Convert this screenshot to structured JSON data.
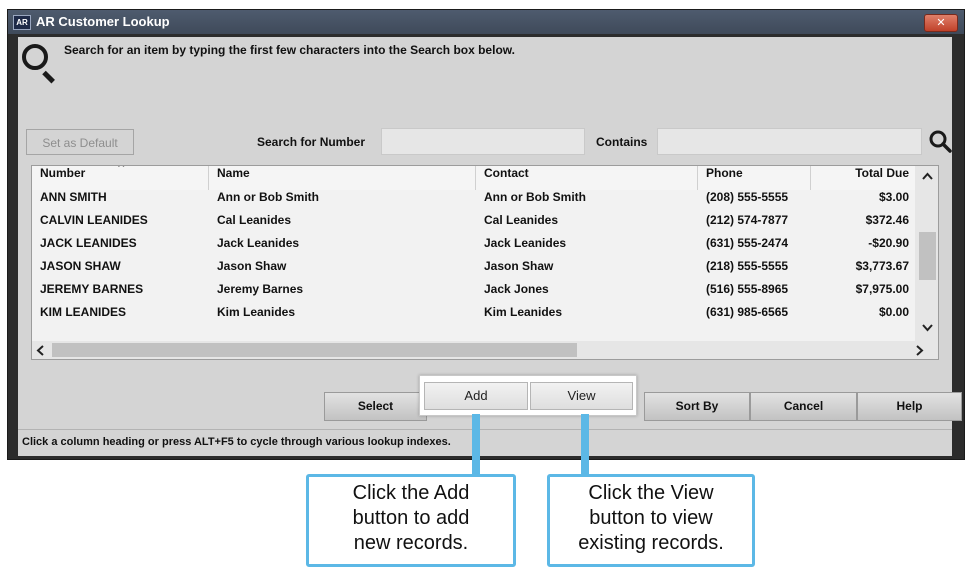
{
  "window": {
    "app_icon": "AR",
    "title": "AR Customer Lookup",
    "close_glyph": "✕"
  },
  "instruction": "Search for an item by typing the first few characters into the Search box below.",
  "search": {
    "set_default_label": "Set as Default",
    "search_number_label": "Search for Number",
    "search_number_value": "",
    "contains_label": "Contains",
    "contains_value": ""
  },
  "table": {
    "columns": [
      "Number",
      "Name",
      "Contact",
      "Phone",
      "Total Due"
    ],
    "sort_indicator": "^",
    "rows": [
      [
        "ANN SMITH",
        "Ann or Bob Smith",
        "Ann or Bob Smith",
        "(208) 555-5555",
        "$3.00"
      ],
      [
        "CALVIN LEANIDES",
        "Cal Leanides",
        "Cal Leanides",
        "(212) 574-7877",
        "$372.46"
      ],
      [
        "JACK LEANIDES",
        "Jack Leanides",
        "Jack Leanides",
        "(631) 555-2474",
        "-$20.90"
      ],
      [
        "JASON SHAW",
        "Jason Shaw",
        "Jason Shaw",
        "(218) 555-5555",
        "$3,773.67"
      ],
      [
        "JEREMY BARNES",
        "Jeremy Barnes",
        "Jack Jones",
        "(516) 555-8965",
        "$7,975.00"
      ],
      [
        "KIM LEANIDES",
        "Kim Leanides",
        "Kim Leanides",
        "(631) 985-6565",
        "$0.00"
      ]
    ]
  },
  "buttons": {
    "select": "Select",
    "add": "Add",
    "view": "View",
    "sort_by": "Sort By",
    "cancel": "Cancel",
    "help": "Help"
  },
  "status_text": "Click a column heading or press ALT+F5 to cycle through various lookup indexes.",
  "callouts": {
    "add": [
      "Click the Add",
      "button to add",
      "new records."
    ],
    "view": [
      "Click the View",
      "button to view",
      "existing records."
    ]
  },
  "colors": {
    "callout_border": "#5cb8e6",
    "window_frame": "#2c2c2c",
    "client_bg": "#d4d4d4"
  }
}
